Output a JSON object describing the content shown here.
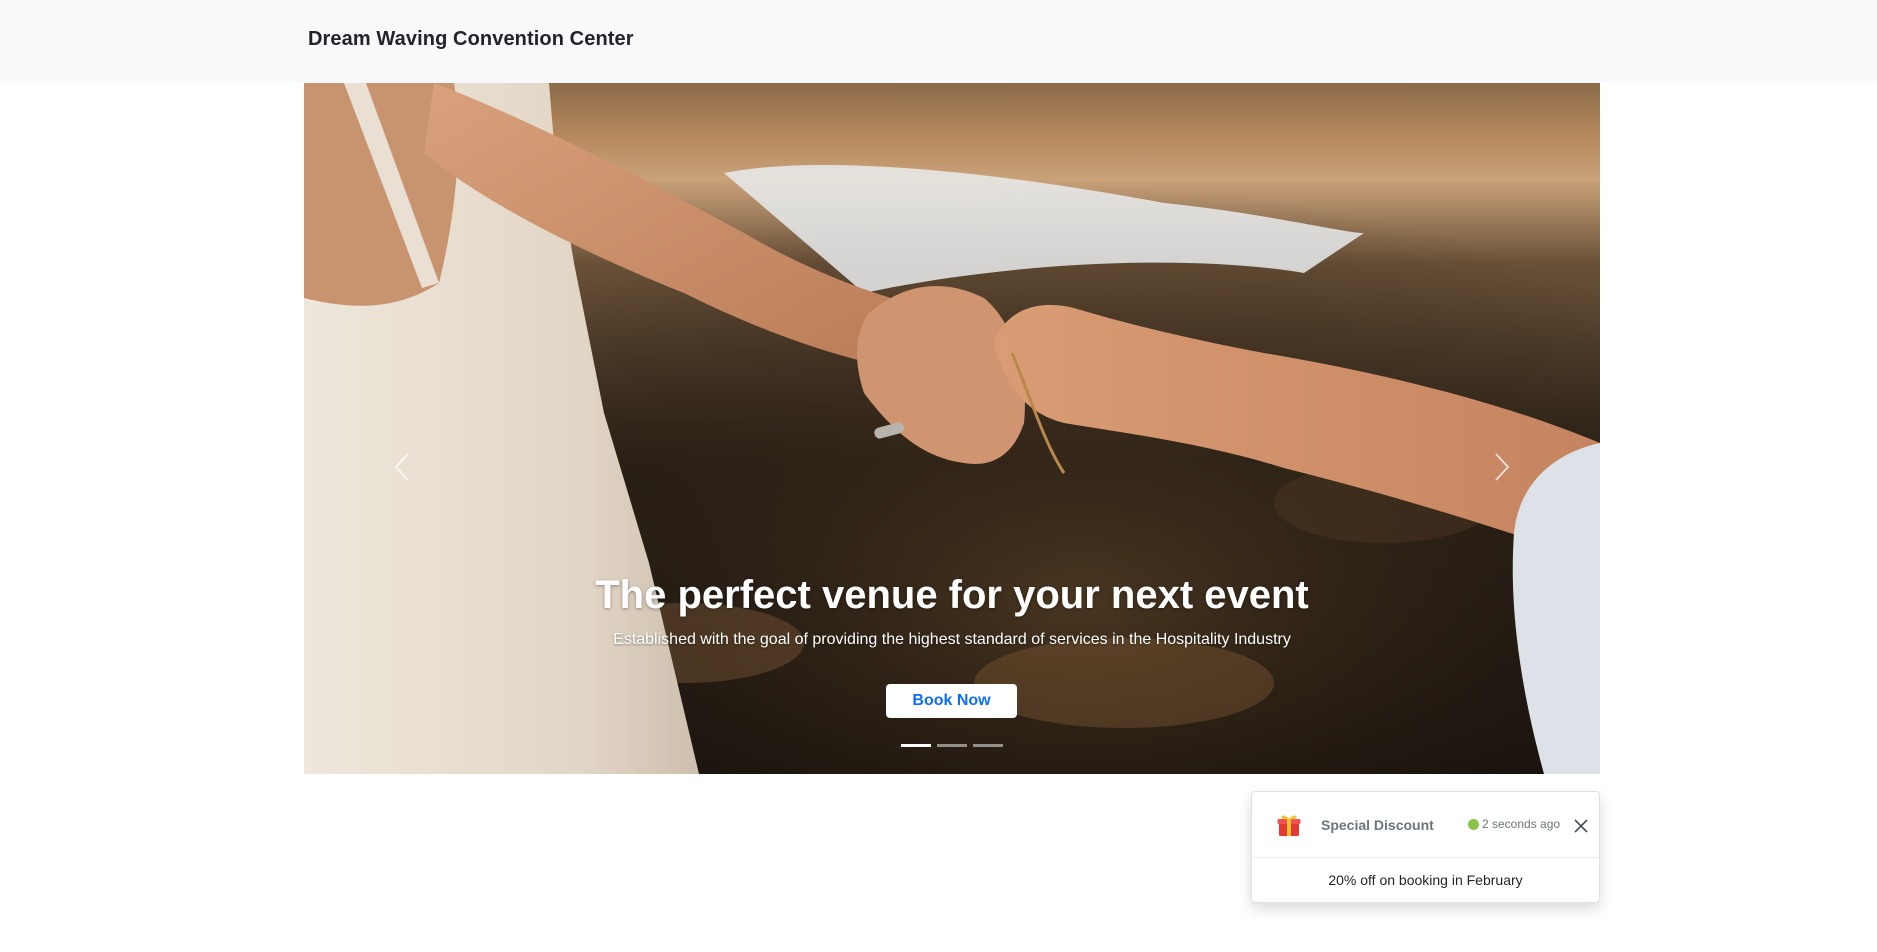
{
  "navbar": {
    "brand": "Dream Waving Convention Center"
  },
  "hero": {
    "title": "The perfect venue for your next event",
    "subtitle": "Established with the goal of providing the highest standard of services in the Hospitality Industry",
    "cta_label": "Book Now",
    "prev_icon": "chevron-left-icon",
    "next_icon": "chevron-right-icon",
    "slide_count": 3,
    "active_slide": 1,
    "image_subject": "couple-holding-hands-photo"
  },
  "toast": {
    "icon": "gift-icon",
    "title": "Special Discount",
    "time": "2 seconds ago",
    "status_color": "#8bc34a",
    "close_icon": "close-icon",
    "body": "20% off on booking in February"
  },
  "colors": {
    "accent": "#0d6efd",
    "navbar_bg": "#f8f9fa"
  }
}
